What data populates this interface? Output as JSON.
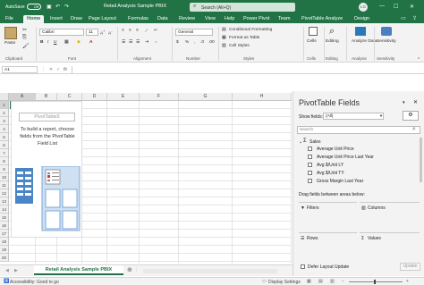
{
  "titlebar": {
    "autosave": "AutoSave",
    "toggle": "Off",
    "filename": "Retail Analysis Sample PBIX",
    "search": "Search (Alt+Q)",
    "lg": "LG",
    "minimize": "—",
    "maximize": "☐",
    "close": "✕"
  },
  "tabs": [
    "File",
    "Home",
    "Insert",
    "Draw",
    "Page Layout",
    "Formulas",
    "Data",
    "Review",
    "View",
    "Help",
    "Power Pivot",
    "Team",
    "PivotTable Analyze",
    "Design"
  ],
  "ribbon": {
    "paste": "Paste",
    "clipboard": "Clipboard",
    "font_name": "Calibri",
    "font_size": "11",
    "font": "Font",
    "alignment": "Alignment",
    "number_format": "General",
    "number": "Number",
    "cond_format": "Conditional Formatting",
    "format_table": "Format as Table",
    "cell_styles": "Cell Styles",
    "styles": "Styles",
    "cells_btn": "Cells",
    "cells": "Cells",
    "editing_btn": "Editing",
    "editing": "Editing",
    "analyze_data": "Analyze Data",
    "analysis": "Analysis",
    "sensitivity_btn": "Sensitivity",
    "sensitivity": "Sensitivity"
  },
  "formula_bar": {
    "name_box": "A1",
    "fx": "fx"
  },
  "columns": [
    "A",
    "B",
    "C",
    "D",
    "E",
    "F",
    "G",
    "H"
  ],
  "rows": [
    "1",
    "2",
    "3",
    "4",
    "5",
    "6",
    "7",
    "8",
    "9",
    "10",
    "11",
    "12",
    "13",
    "14",
    "15",
    "16",
    "17",
    "18",
    "19",
    "20"
  ],
  "pivot_placeholder": {
    "title": "PivotTable5",
    "text": "To build a report, choose fields from the PivotTable Field List"
  },
  "sheet_tab": "Retail Analysis Sample PBIX",
  "status": {
    "accessibility": "Accessibility: Good to go",
    "display": "Display Settings"
  },
  "pane": {
    "title": "PivotTable Fields",
    "show_fields_label": "Show fields:",
    "show_fields_value": "(All)",
    "search_placeholder": "Search",
    "table": "Sales",
    "fields": [
      "Average Unit Price",
      "Average Unit Price Last Year",
      "Avg $/Unit LY",
      "Avg $/Unit TY",
      "Gross Margin Last Year"
    ],
    "drag_hint": "Drag fields between areas below:",
    "areas": {
      "filters": "Filters",
      "columns": "Columns",
      "rows": "Rows",
      "values": "Values"
    },
    "defer_label": "Defer Layout Update",
    "update_btn": "Update"
  }
}
